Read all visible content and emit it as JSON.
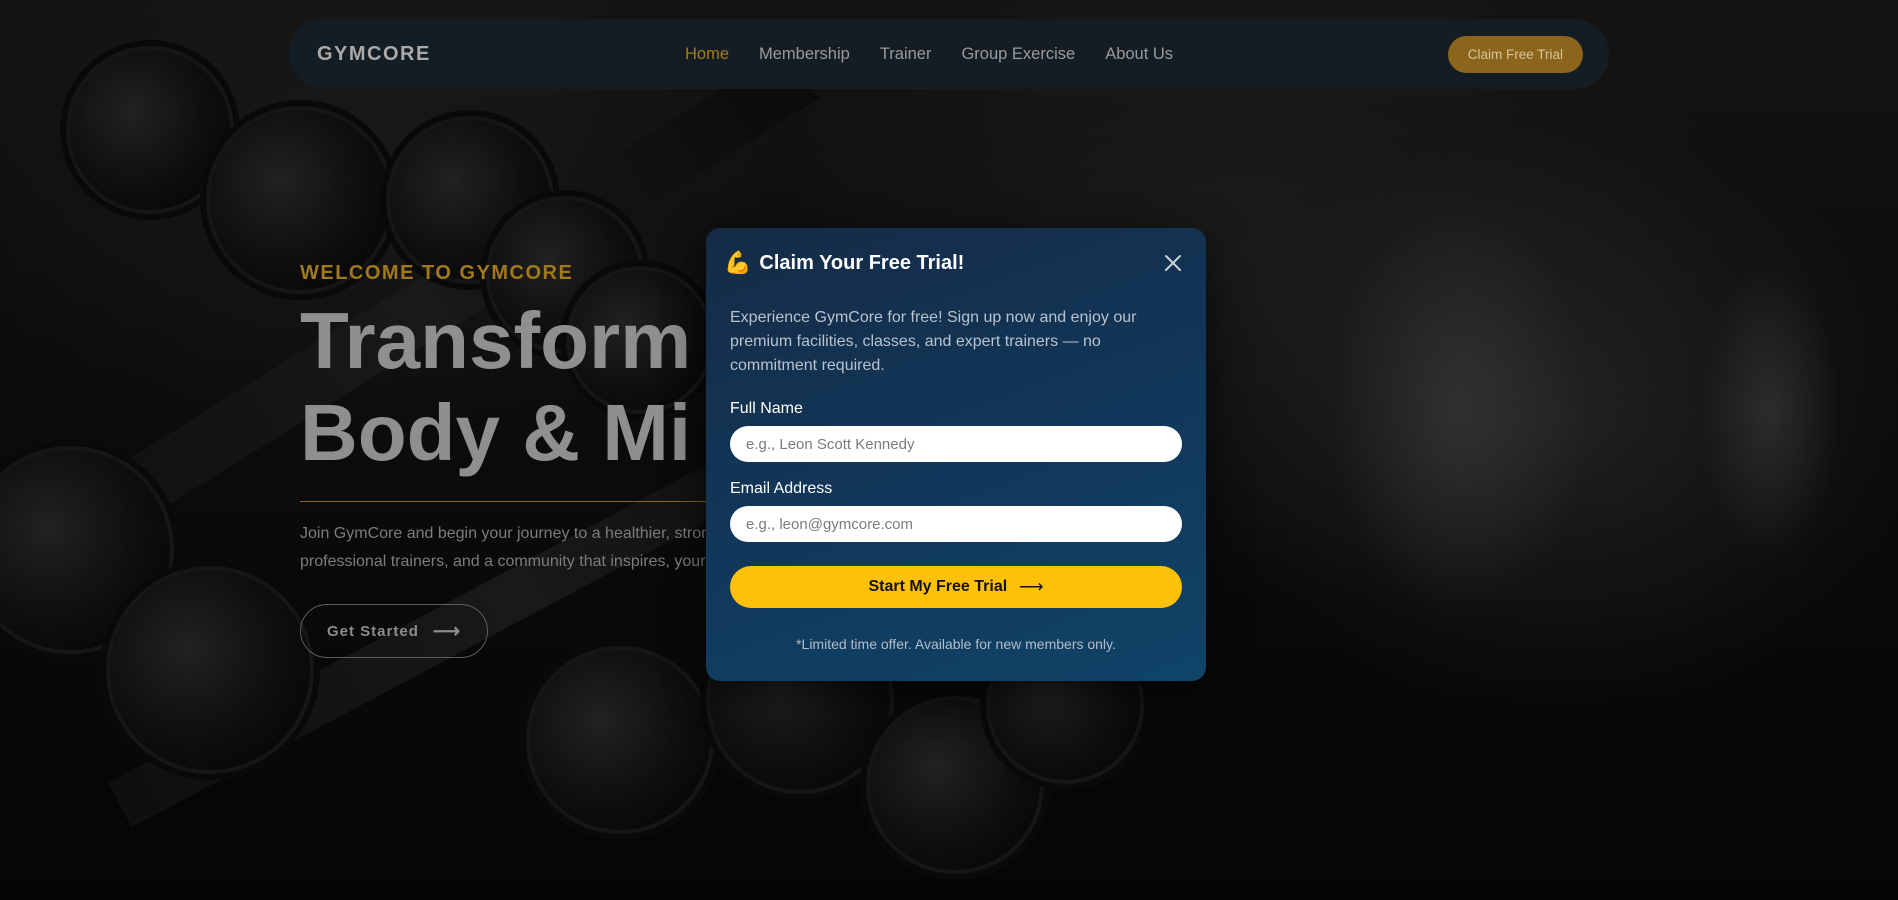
{
  "navbar": {
    "brand": "GYMCORE",
    "links": [
      {
        "label": "Home",
        "active": true
      },
      {
        "label": "Membership",
        "active": false
      },
      {
        "label": "Trainer",
        "active": false
      },
      {
        "label": "Group Exercise",
        "active": false
      },
      {
        "label": "About Us",
        "active": false
      }
    ],
    "cta_label": "Claim Free Trial"
  },
  "hero": {
    "eyebrow": "WELCOME TO GYMCORE",
    "title_line1": "Transform Y",
    "title_line2": "Body & Mi",
    "description_line1": "Join GymCore and begin your journey to a healthier, strong",
    "description_line2": "professional trainers, and a community that inspires, your",
    "button_label": "Get Started",
    "button_icon": "arrow-right-icon"
  },
  "modal": {
    "emoji": "💪",
    "title": "Claim Your Free Trial!",
    "close_icon": "close-icon",
    "description": "Experience GymCore for free! Sign up now and enjoy our premium facilities, classes, and expert trainers — no commitment required.",
    "full_name": {
      "label": "Full Name",
      "placeholder": "e.g., Leon Scott Kennedy",
      "value": ""
    },
    "email": {
      "label": "Email Address",
      "placeholder": "e.g., leon@gymcore.com",
      "value": ""
    },
    "submit_label": "Start My Free Trial",
    "submit_icon": "arrow-right-icon",
    "note": "*Limited time offer. Available for new members only."
  },
  "colors": {
    "accent": "#ffc107",
    "brand_gold": "#a2781c",
    "modal_bg": "#11385b",
    "navbar_bg": "#161e26"
  }
}
